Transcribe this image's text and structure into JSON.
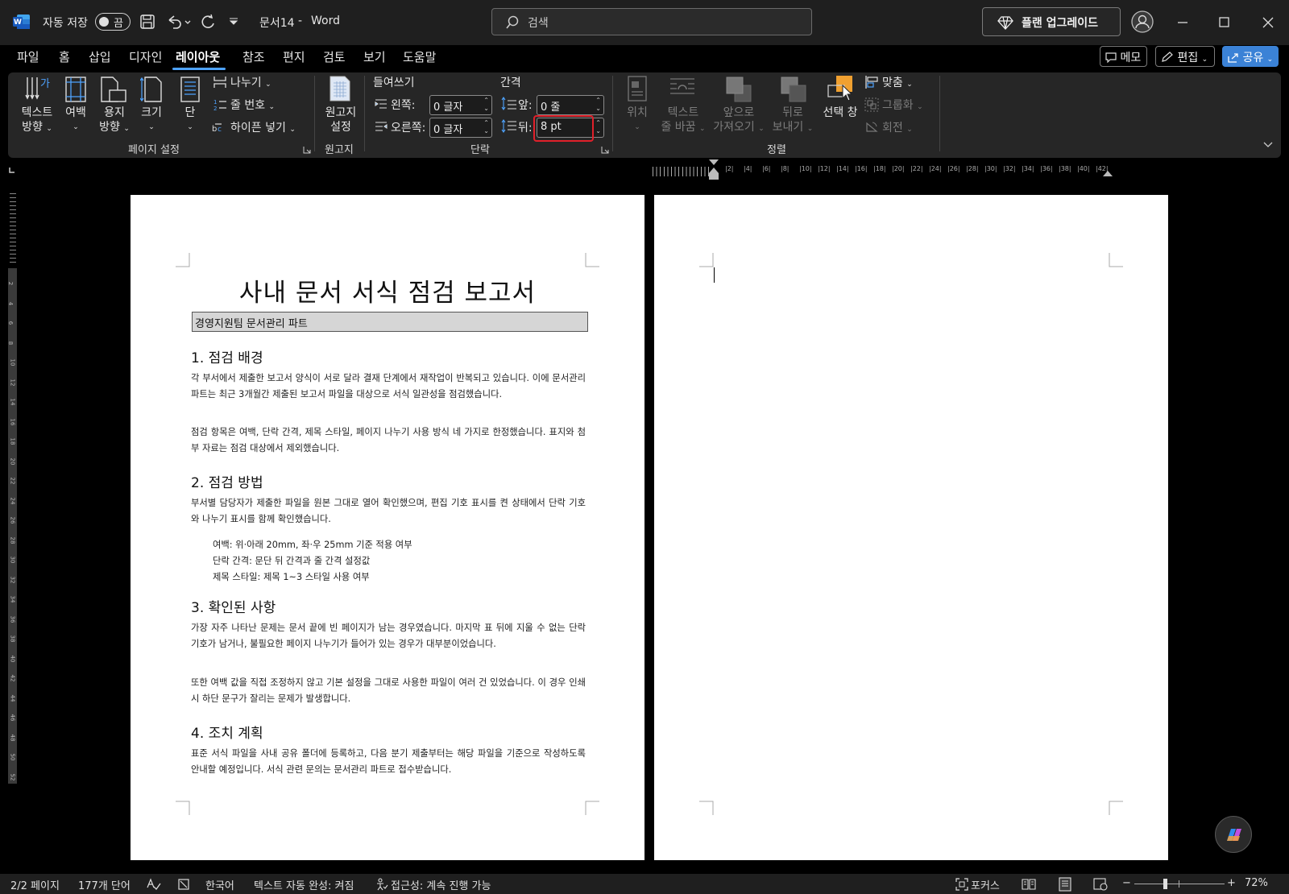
{
  "titlebar": {
    "autosave_label": "자동 저장",
    "autosave_state": "끔",
    "doc_title": "문서14",
    "separator": "-",
    "app_name": "Word",
    "search_placeholder": "검색",
    "upgrade_label": "플랜 업그레이드"
  },
  "menu": {
    "tabs": [
      "파일",
      "홈",
      "삽입",
      "디자인",
      "레이아웃",
      "참조",
      "편지",
      "검토",
      "보기",
      "도움말"
    ],
    "active_tab": "레이아웃",
    "memo_label": "메모",
    "edit_label": "편집",
    "share_label": "공유"
  },
  "ribbon": {
    "page_setup": {
      "text_direction": [
        "텍스트",
        "방향"
      ],
      "margins": "여백",
      "orientation": [
        "용지",
        "방향"
      ],
      "size": "크기",
      "columns": "단",
      "breaks": "나누기",
      "line_numbers": "줄 번호",
      "hyphenation": "하이픈 넣기",
      "group_label": "페이지 설정"
    },
    "manuscript": {
      "label": [
        "원고지",
        "설정"
      ],
      "group_label": "원고지"
    },
    "paragraph": {
      "indent_label": "들여쓰기",
      "spacing_label": "간격",
      "left_label": "왼쪽:",
      "left_value": "0 글자",
      "right_label": "오른쪽:",
      "right_value": "0 글자",
      "before_label": "앞:",
      "before_value": "0 줄",
      "after_label": "뒤:",
      "after_value": "8 pt",
      "group_label": "단락"
    },
    "arrange": {
      "position": "위치",
      "wrap_text": [
        "텍스트",
        "줄 바꿈"
      ],
      "bring_forward": [
        "앞으로",
        "가져오기"
      ],
      "send_backward": [
        "뒤로",
        "보내기"
      ],
      "selection_pane": [
        "선택 창"
      ],
      "align": "맞춤",
      "group": "그룹화",
      "rotate": "회전",
      "group_label": "정렬"
    }
  },
  "ruler": {
    "ticks": [
      "2",
      "4",
      "6",
      "8",
      "10",
      "12",
      "14",
      "16",
      "18",
      "20",
      "22",
      "24",
      "26",
      "28",
      "30",
      "32",
      "34",
      "36",
      "38",
      "40",
      "42"
    ],
    "vticks": [
      "2",
      "4",
      "6",
      "8",
      "10",
      "12",
      "14",
      "16",
      "18",
      "20",
      "22",
      "24",
      "26",
      "28",
      "30",
      "32",
      "34",
      "36",
      "38",
      "40",
      "42",
      "44",
      "46",
      "48",
      "50",
      "52"
    ]
  },
  "document": {
    "title": "사내 문서 서식 점검 보고서",
    "subtitle": "경영지원팀 문서관리 파트",
    "sections": [
      {
        "heading": "1. 점검 배경",
        "paragraphs": [
          "각 부서에서 제출한 보고서 양식이 서로 달라 결재 단계에서 재작업이 반복되고 있습니다. 이에 문서관리 파트는 최근 3개월간 제출된 보고서 파일을 대상으로 서식 일관성을 점검했습니다.",
          "점검 항목은 여백, 단락 간격, 제목 스타일, 페이지 나누기 사용 방식 네 가지로 한정했습니다. 표지와 첨부 자료는 점검 대상에서 제외했습니다."
        ]
      },
      {
        "heading": "2. 점검 방법",
        "paragraphs": [
          "부서별 담당자가 제출한 파일을 원본 그대로 열어 확인했으며, 편집 기호 표시를 켠 상태에서 단락 기호와 나누기 표시를 함께 확인했습니다."
        ],
        "items": [
          "여백: 위·아래 20mm, 좌·우 25mm 기준 적용 여부",
          "단락 간격: 문단 뒤 간격과 줄 간격 설정값",
          "제목 스타일: 제목 1~3 스타일 사용 여부"
        ]
      },
      {
        "heading": "3. 확인된 사항",
        "paragraphs": [
          "가장 자주 나타난 문제는 문서 끝에 빈 페이지가 남는 경우였습니다. 마지막 표 뒤에 지울 수 없는 단락 기호가 남거나, 불필요한 페이지 나누기가 들어가 있는 경우가 대부분이었습니다.",
          "또한 여백 값을 직접 조정하지 않고 기본 설정을 그대로 사용한 파일이 여러 건 있었습니다. 이 경우 인쇄 시 하단 문구가 잘리는 문제가 발생합니다."
        ]
      },
      {
        "heading": "4. 조치 계획",
        "paragraphs": [
          "표준 서식 파일을 사내 공유 폴더에 등록하고, 다음 분기 제출부터는 해당 파일을 기준으로 작성하도록 안내할 예정입니다. 서식 관련 문의는 문서관리 파트로 접수받습니다."
        ]
      }
    ]
  },
  "status": {
    "page": "2/2 페이지",
    "words": "177개 단어",
    "language": "한국어",
    "autocomplete": "텍스트 자동 완성: 켜짐",
    "accessibility": "접근성: 계속 진행 가능",
    "focus": "포커스",
    "zoom_minus": "−",
    "zoom_plus": "+",
    "zoom": "72%"
  },
  "colors": {
    "accent": "#4ea3ff",
    "highlight_box": "#e0202a",
    "share_button": "#3b82d6",
    "word_logo": "#185abd"
  }
}
